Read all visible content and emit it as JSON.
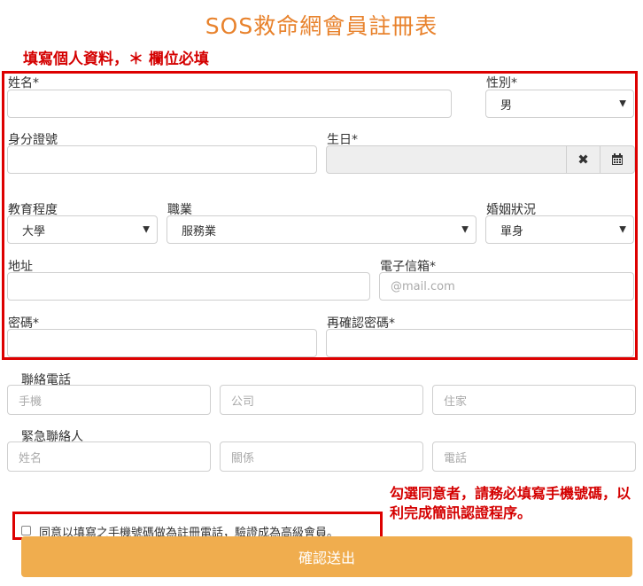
{
  "title": "SOS救命網會員註冊表",
  "note_required": "填寫個人資料，＊ 欄位必填",
  "fields": {
    "name": {
      "label": "姓名*",
      "value": ""
    },
    "gender": {
      "label": "性別*",
      "value": "男"
    },
    "id_number": {
      "label": "身分證號",
      "value": ""
    },
    "birthday": {
      "label": "生日*",
      "value": ""
    },
    "education": {
      "label": "教育程度",
      "value": "大學"
    },
    "occupation": {
      "label": "職業",
      "value": "服務業"
    },
    "marital": {
      "label": "婚姻狀況",
      "value": "單身"
    },
    "address": {
      "label": "地址",
      "value": ""
    },
    "email": {
      "label": "電子信箱*",
      "placeholder": "@mail.com"
    },
    "password": {
      "label": "密碼*",
      "value": ""
    },
    "password_confirm": {
      "label": "再確認密碼*",
      "value": ""
    }
  },
  "phone": {
    "label": "聯絡電話",
    "mobile_placeholder": "手機",
    "office_placeholder": "公司",
    "home_placeholder": "住家"
  },
  "emergency": {
    "label": "緊急聯絡人",
    "name_placeholder": "姓名",
    "relation_placeholder": "關係",
    "phone_placeholder": "電話"
  },
  "note_agree": "勾選同意者，請務必填寫手機號碼，以利完成簡訊認證程序。",
  "agree_label": "同意以填寫之手機號碼做為註冊電話，驗證成為高級會員。",
  "agree_checked": false,
  "submit_label": "確認送出",
  "icons": {
    "clear": "times-icon",
    "calendar": "calendar-icon"
  },
  "colors": {
    "accent": "#e8822c",
    "annotation": "#dd0000",
    "button": "#f0ad4e"
  }
}
